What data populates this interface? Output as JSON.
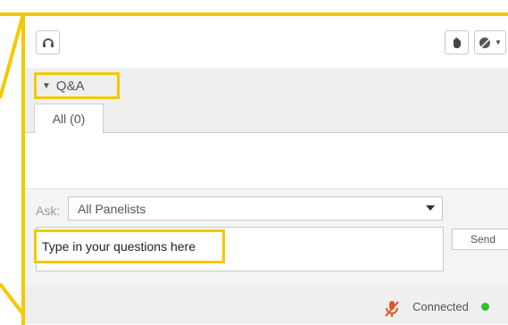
{
  "panel": {
    "accent_color": "#f6c800"
  },
  "toolbar": {
    "left_icon": "headset-icon",
    "raise_hand_icon": "raise-hand-icon",
    "options_icon": "emoticon-options-icon"
  },
  "qa": {
    "title": "Q&A",
    "collapse_icon": "triangle-down-icon",
    "close_label": "×"
  },
  "tabs": [
    {
      "label": "All (0)",
      "selected": true
    }
  ],
  "compose": {
    "ask_label": "Ask:",
    "recipient_selected": "All Panelists",
    "question_placeholder": "Type in your questions here",
    "send_label": "Send"
  },
  "status": {
    "mic_icon": "muted-microphone-icon",
    "text": "Connected",
    "indicator_color": "#2bc42b"
  }
}
